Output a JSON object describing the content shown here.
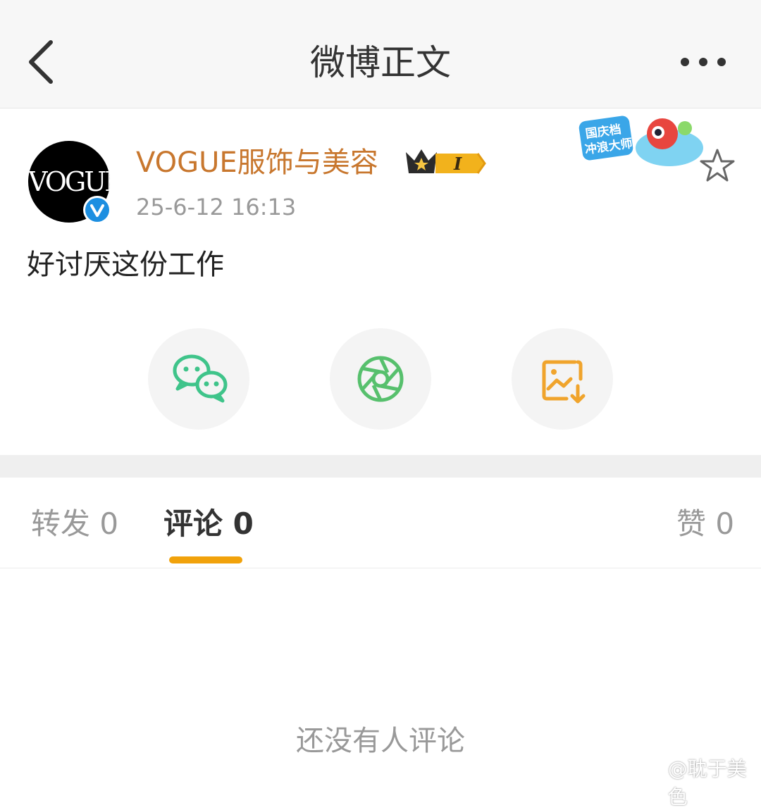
{
  "header": {
    "title": "微博正文"
  },
  "post": {
    "avatar_text": "VOGUE",
    "username": "VOGUE服饰与美容",
    "member_level": "I",
    "timestamp": "25-6-12 16:13",
    "badge_line1": "国庆档",
    "badge_line2": "冲浪大师",
    "content": "好讨厌这份工作"
  },
  "share": [
    {
      "name": "wechat",
      "color": "#3fc48a"
    },
    {
      "name": "moments",
      "color": "#57c06d"
    },
    {
      "name": "save-image",
      "color": "#f0a42c"
    }
  ],
  "tabs": {
    "repost": "转发 0",
    "comment": "评论 0",
    "like": "赞 0"
  },
  "colors": {
    "accent": "#f1a20b",
    "username": "#c8772e",
    "verified": "#1d8fe1"
  },
  "empty_text": "还没有人评论",
  "watermark": "@耽于美色"
}
